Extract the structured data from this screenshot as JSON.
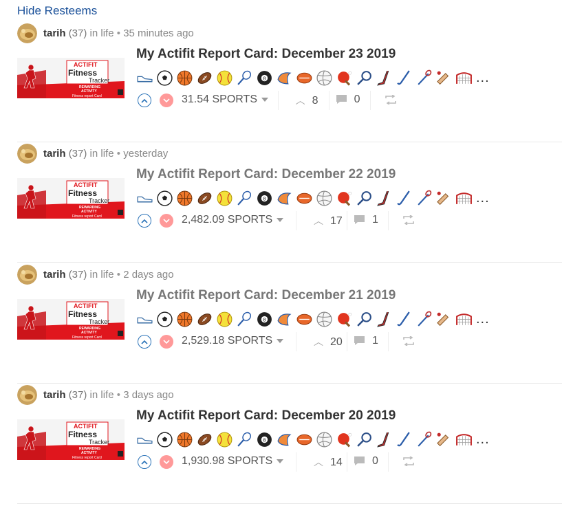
{
  "hide_resteems": "Hide Resteems",
  "sports_icons": [
    "shoe-icon",
    "soccer-ball-icon",
    "basketball-icon",
    "american-football-icon",
    "softball-icon",
    "badminton-icon",
    "billiards-8-ball-icon",
    "rugby-ball-icon",
    "australian-football-icon",
    "volleyball-icon",
    "ping-pong-icon",
    "racquet-icon",
    "ice-hockey-icon",
    "field-hockey-icon",
    "lacrosse-icon",
    "cricket-bat-icon",
    "goal-net-icon"
  ],
  "more_icons": "...",
  "posts": [
    {
      "author": "tarih",
      "reputation": "(37)",
      "in_label": "in life",
      "bullet": "•",
      "time": "35 minutes ago",
      "title": "My Actifit Report Card: December 23 2019",
      "payout": "31.54 SPORTS",
      "votes": "8",
      "comments": "0"
    },
    {
      "author": "tarih",
      "reputation": "(37)",
      "in_label": "in life",
      "bullet": "•",
      "time": "yesterday",
      "title": "My Actifit Report Card: December 22 2019",
      "payout": "2,482.09 SPORTS",
      "votes": "17",
      "comments": "1"
    },
    {
      "author": "tarih",
      "reputation": "(37)",
      "in_label": "in life",
      "bullet": "•",
      "time": "2 days ago",
      "title": "My Actifit Report Card: December 21 2019",
      "payout": "2,529.18 SPORTS",
      "votes": "20",
      "comments": "1"
    },
    {
      "author": "tarih",
      "reputation": "(37)",
      "in_label": "in life",
      "bullet": "•",
      "time": "3 days ago",
      "title": "My Actifit Report Card: December 20 2019",
      "payout": "1,930.98 SPORTS",
      "votes": "14",
      "comments": "0"
    }
  ],
  "thumbnail": {
    "line1": "ACTIFIT",
    "line2": "Fitness",
    "line3": "Tracker",
    "line4": "REWARDING",
    "line5": "ACTIVITY",
    "line6": "Fitness report Card"
  },
  "colors": {
    "link": "#1a5099",
    "actifit_red": "#e0161d",
    "upvote_blue": "#2b73b8",
    "downvote_pink": "#ff9999"
  }
}
